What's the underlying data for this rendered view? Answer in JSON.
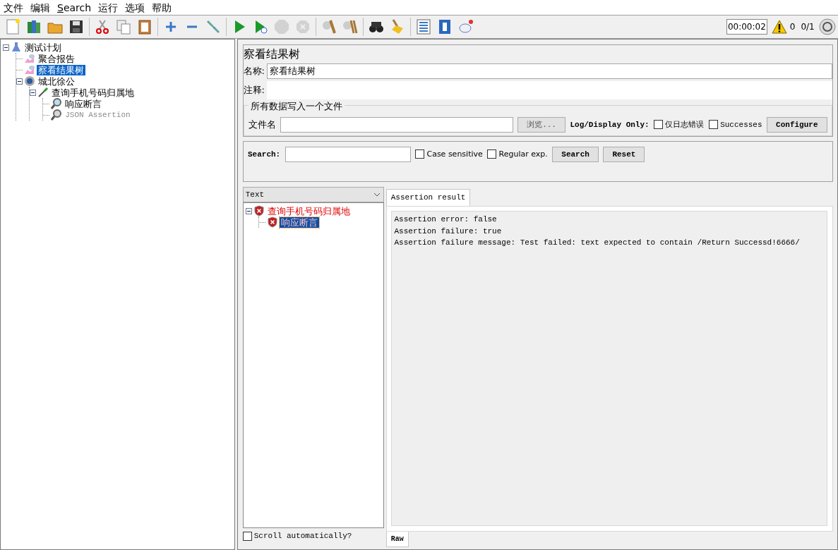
{
  "menu": [
    {
      "label": "文件",
      "underlined": false
    },
    {
      "label": "编辑",
      "underlined": false
    },
    {
      "label": "Search",
      "underlined": true
    },
    {
      "label": "运行",
      "underlined": false
    },
    {
      "label": "选项",
      "underlined": false
    },
    {
      "label": "帮助",
      "underlined": false
    }
  ],
  "toolbar": [
    [
      {
        "kind": "new",
        "disabled": false
      },
      {
        "kind": "templates",
        "disabled": false
      },
      {
        "kind": "open",
        "disabled": false
      },
      {
        "kind": "save",
        "disabled": false
      }
    ],
    [
      {
        "kind": "cut",
        "disabled": false
      },
      {
        "kind": "copy",
        "disabled": false
      },
      {
        "kind": "paste",
        "disabled": false
      }
    ],
    [
      {
        "kind": "expand",
        "disabled": false
      },
      {
        "kind": "collapse",
        "disabled": false
      },
      {
        "kind": "toggle",
        "disabled": false
      }
    ],
    [
      {
        "kind": "start",
        "disabled": false
      },
      {
        "kind": "start-no-pause",
        "disabled": false
      },
      {
        "kind": "stop",
        "disabled": true
      },
      {
        "kind": "shutdown",
        "disabled": true
      }
    ],
    [
      {
        "kind": "clear",
        "disabled": false
      },
      {
        "kind": "clear-all",
        "disabled": false
      }
    ],
    [
      {
        "kind": "search",
        "disabled": false
      },
      {
        "kind": "reset",
        "disabled": false
      }
    ],
    [
      {
        "kind": "functions",
        "disabled": false
      },
      {
        "kind": "help",
        "disabled": false
      },
      {
        "kind": "remote",
        "disabled": false
      }
    ]
  ],
  "status": {
    "timer": "00:00:02",
    "warnings": "0",
    "threads": "0/1"
  },
  "tree": [
    {
      "label": "测试计划",
      "kind": "plan",
      "expanded": true,
      "selected": false,
      "disabled": false,
      "children": [
        {
          "label": "聚合报告",
          "kind": "listener",
          "selected": false,
          "disabled": false
        },
        {
          "label": "察看结果树",
          "kind": "listener",
          "selected": true,
          "disabled": false
        },
        {
          "label": "城北徐公",
          "kind": "thread-group",
          "expanded": true,
          "selected": false,
          "disabled": false,
          "children": [
            {
              "label": "查询手机号码归属地",
              "kind": "sampler",
              "expanded": true,
              "selected": false,
              "disabled": false,
              "children": [
                {
                  "label": "响应断言",
                  "kind": "assertion",
                  "selected": false,
                  "disabled": false
                },
                {
                  "label": "JSON Assertion",
                  "kind": "assertion",
                  "selected": false,
                  "disabled": true
                }
              ]
            }
          ]
        }
      ]
    }
  ],
  "panel": {
    "title": "察看结果树",
    "name_label": "名称:",
    "name_value": "察看结果树",
    "comment_label": "注释:",
    "file_group": {
      "legend": "所有数据写入一个文件",
      "filename_label": "文件名",
      "browse": "浏览...",
      "log_label": "Log/Display Only:",
      "checkboxes": [
        {
          "label": "仅日志错误",
          "checked": false
        },
        {
          "label": "Successes",
          "checked": false
        }
      ],
      "configure": "Configure"
    }
  },
  "search": {
    "label": "Search:",
    "checkboxes": [
      {
        "label": "Case sensitive",
        "checked": false
      },
      {
        "label": "Regular exp.",
        "checked": false
      }
    ],
    "buttons": [
      "Search",
      "Reset"
    ]
  },
  "results": {
    "renderer": "Text",
    "tree": [
      {
        "label": "查询手机号码归属地",
        "failed": true,
        "expanded": true,
        "selected": false,
        "children": [
          {
            "label": "响应断言",
            "failed": true,
            "selected": true
          }
        ]
      }
    ],
    "tabs": [
      {
        "label": "Assertion result",
        "selected": true
      }
    ],
    "lines": [
      "Assertion error: false",
      "Assertion failure: true",
      "Assertion failure message: Test failed: text expected to contain /Return Successd!6666/"
    ],
    "bottom_tabs": [
      {
        "label": "Raw",
        "selected": true
      }
    ],
    "scroll": {
      "label": "Scroll automatically?",
      "checked": false
    }
  }
}
